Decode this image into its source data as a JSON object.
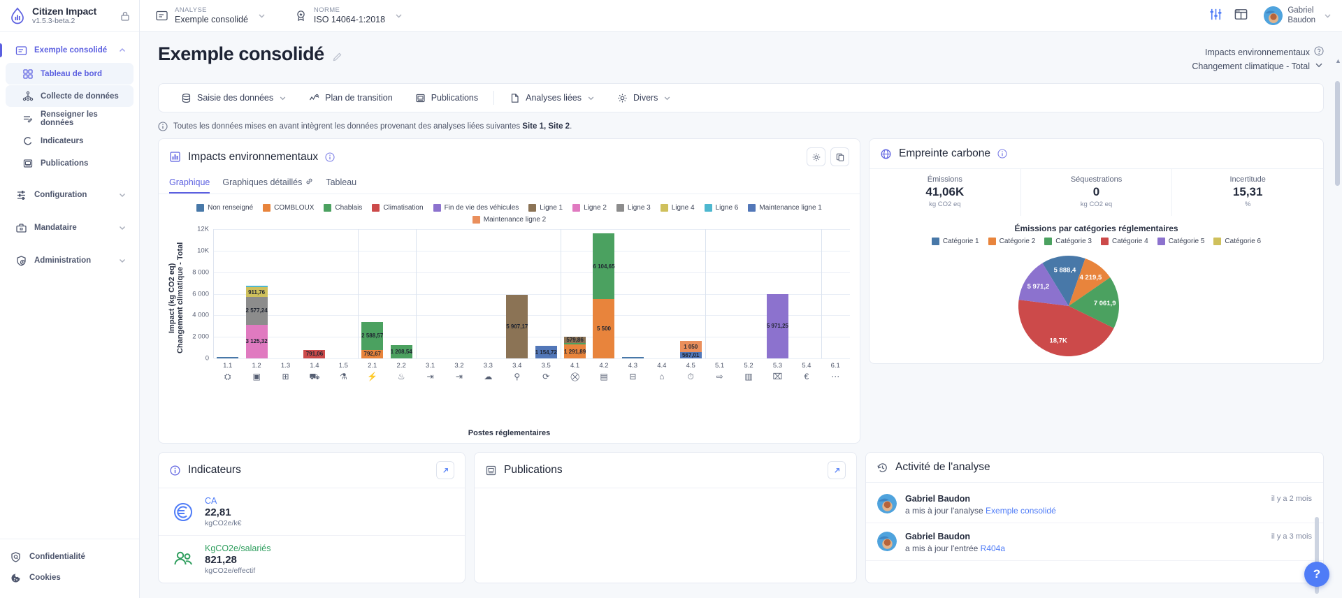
{
  "brand": {
    "name": "Citizen Impact",
    "version": "v1.5.3-beta.2",
    "lock_icon": "lock-icon"
  },
  "sidebar": {
    "root": {
      "label": "Exemple consolidé",
      "icon": "folder-icon",
      "chevron": "chevron-up-icon"
    },
    "sub_items": [
      {
        "label": "Tableau de bord",
        "icon": "dashboard-icon",
        "selected": true
      },
      {
        "label": "Collecte de données",
        "icon": "network-icon",
        "selected": true
      },
      {
        "label": "Renseigner les données",
        "icon": "edit-list-icon",
        "selected": false
      },
      {
        "label": "Indicateurs",
        "icon": "gauge-icon",
        "selected": false
      },
      {
        "label": "Publications",
        "icon": "publication-icon",
        "selected": false
      }
    ],
    "sections": [
      {
        "label": "Configuration",
        "icon": "sliders-icon",
        "chevron": "chevron-down-icon"
      },
      {
        "label": "Mandataire",
        "icon": "briefcase-icon",
        "chevron": "chevron-down-icon"
      },
      {
        "label": "Administration",
        "icon": "shield-user-icon",
        "chevron": "chevron-down-icon"
      }
    ],
    "footer": [
      {
        "label": "Confidentialité",
        "icon": "shield-icon"
      },
      {
        "label": "Cookies",
        "icon": "cookie-icon"
      }
    ]
  },
  "topbar": {
    "analyse": {
      "caption": "ANALYSE",
      "value": "Exemple consolidé",
      "icon": "folder-icon",
      "chevron": "chevron-down-icon"
    },
    "norme": {
      "caption": "NORME",
      "value": "ISO 14064-1:2018",
      "icon": "badge-icon",
      "chevron": "chevron-down-icon"
    },
    "settings_icon": "sliders-icon",
    "layout_icon": "layout-icon",
    "user": {
      "name_line1": "Gabriel",
      "name_line2": "Baudon",
      "avatar": "avatar",
      "chevron": "chevron-down-icon"
    }
  },
  "page": {
    "title": "Exemple consolidé",
    "edit_icon": "pencil-icon",
    "impacts_label": "Impacts environnementaux",
    "impacts_help_icon": "question-circle-icon",
    "impacts_selected": "Changement climatique - Total",
    "impacts_chevron": "chevron-down-icon"
  },
  "toolbar": {
    "items": [
      {
        "label": "Saisie des données",
        "icon": "database-icon",
        "chevron": true
      },
      {
        "label": "Plan de transition",
        "icon": "trend-icon",
        "chevron": false
      },
      {
        "label": "Publications",
        "icon": "publication-icon",
        "chevron": false
      },
      {
        "divider": true
      },
      {
        "label": "Analyses liées",
        "icon": "document-icon",
        "chevron": true
      },
      {
        "label": "Divers",
        "icon": "gear-icon",
        "chevron": true
      }
    ]
  },
  "notice": {
    "icon": "info-icon",
    "text_before": "Toutes les données mises en avant intègrent les données provenant des analyses liées suivantes ",
    "links": "Site 1, Site 2",
    "text_after": "."
  },
  "impacts_card": {
    "icon": "bar-chart-icon",
    "title": "Impacts environnementaux",
    "info_icon": "info-icon",
    "actions": [
      {
        "name": "settings-button",
        "icon": "gear-icon"
      },
      {
        "name": "copy-button",
        "icon": "copy-icon"
      }
    ],
    "tabs": [
      {
        "label": "Graphique",
        "active": true,
        "icon": null
      },
      {
        "label": "Graphiques détaillés",
        "active": false,
        "icon": "link-icon"
      },
      {
        "label": "Tableau",
        "active": false,
        "icon": null
      }
    ]
  },
  "chart_data": {
    "type": "bar",
    "stacked": true,
    "title": "",
    "xlabel": "Postes réglementaires",
    "ylabel": "Impact (kg CO2 eq)\nChangement climatique - Total",
    "ylim": [
      0,
      12000
    ],
    "yticks": [
      0,
      2000,
      4000,
      6000,
      8000,
      10000,
      12000
    ],
    "ytick_labels": [
      "0",
      "2 000",
      "4 000",
      "6 000",
      "8 000",
      "10K",
      "12K"
    ],
    "grid": true,
    "legend_position": "top",
    "series": [
      {
        "name": "Non renseigné",
        "color": "#4878a8"
      },
      {
        "name": "COMBLOUX",
        "color": "#e8843c"
      },
      {
        "name": "Chablais",
        "color": "#4ba160"
      },
      {
        "name": "Climatisation",
        "color": "#cc4a4a"
      },
      {
        "name": "Fin de vie des véhicules",
        "color": "#8c72ce"
      },
      {
        "name": "Ligne 1",
        "color": "#8b7355"
      },
      {
        "name": "Ligne 2",
        "color": "#e07ac0"
      },
      {
        "name": "Ligne 3",
        "color": "#8c8c8c"
      },
      {
        "name": "Ligne 4",
        "color": "#cfc05c"
      },
      {
        "name": "Ligne 6",
        "color": "#4db7cf"
      },
      {
        "name": "Maintenance ligne 1",
        "color": "#5277b8"
      },
      {
        "name": "Maintenance ligne 2",
        "color": "#ea8f5c"
      }
    ],
    "categories": [
      "1.1",
      "1.2",
      "1.3",
      "1.4",
      "1.5",
      "2.1",
      "2.2",
      "3.1",
      "3.2",
      "3.3",
      "3.4",
      "3.5",
      "4.1",
      "4.2",
      "4.3",
      "4.4",
      "4.5",
      "5.1",
      "5.2",
      "5.3",
      "5.4",
      "6.1"
    ],
    "category_icons": [
      "factory-icon",
      "fuel-icon",
      "chart-icon",
      "truck-icon",
      "leak-icon",
      "bolt-icon",
      "steam-icon",
      "freight-icon",
      "freight2-icon",
      "air-icon",
      "person-icon",
      "travel-icon",
      "cart-icon",
      "building-icon",
      "trash-icon",
      "home-icon",
      "energy-icon",
      "sold-icon",
      "use-icon",
      "eol-icon",
      "euro-icon",
      "other-icon"
    ],
    "bars": [
      {
        "category": "1.1",
        "segments": [
          {
            "series": "Non renseigné",
            "value": 120,
            "label": ""
          }
        ]
      },
      {
        "category": "1.2",
        "segments": [
          {
            "series": "Ligne 2",
            "value": 3125.32,
            "label": "3 125,32"
          },
          {
            "series": "Ligne 3",
            "value": 2577.24,
            "label": "2 577,24"
          },
          {
            "series": "Ligne 4",
            "value": 911.76,
            "label": "911,76"
          },
          {
            "series": "Ligne 6",
            "value": 90,
            "label": ""
          }
        ]
      },
      {
        "category": "1.3",
        "segments": []
      },
      {
        "category": "1.4",
        "segments": [
          {
            "series": "Climatisation",
            "value": 791.06,
            "label": "791,06"
          }
        ]
      },
      {
        "category": "1.5",
        "segments": []
      },
      {
        "category": "2.1",
        "segments": [
          {
            "series": "COMBLOUX",
            "value": 792.67,
            "label": "792,67"
          },
          {
            "series": "Chablais",
            "value": 2588.57,
            "label": "2 588,57"
          }
        ]
      },
      {
        "category": "2.2",
        "segments": [
          {
            "series": "Chablais",
            "value": 1208.54,
            "label": "1 208,54"
          }
        ]
      },
      {
        "category": "3.1",
        "segments": []
      },
      {
        "category": "3.2",
        "segments": []
      },
      {
        "category": "3.3",
        "segments": []
      },
      {
        "category": "3.4",
        "segments": [
          {
            "series": "Ligne 1",
            "value": 5907.17,
            "label": "5 907,17"
          }
        ]
      },
      {
        "category": "3.5",
        "segments": [
          {
            "series": "Maintenance ligne 1",
            "value": 1154.72,
            "label": "1 154,72"
          }
        ]
      },
      {
        "category": "4.1",
        "segments": [
          {
            "series": "COMBLOUX",
            "value": 1291.89,
            "label": "1 291,89"
          },
          {
            "series": "Chablais",
            "value": 110,
            "label": ""
          },
          {
            "series": "Ligne 1",
            "value": 579.86,
            "label": "579,86"
          }
        ]
      },
      {
        "category": "4.2",
        "segments": [
          {
            "series": "COMBLOUX",
            "value": 5500,
            "label": "5 500"
          },
          {
            "series": "Chablais",
            "value": 6104.65,
            "label": "6 104,65"
          }
        ]
      },
      {
        "category": "4.3",
        "segments": [
          {
            "series": "Non renseigné",
            "value": 70,
            "label": ""
          }
        ]
      },
      {
        "category": "4.4",
        "segments": []
      },
      {
        "category": "4.5",
        "segments": [
          {
            "series": "Maintenance ligne 1",
            "value": 567.01,
            "label": "567,01"
          },
          {
            "series": "Maintenance ligne 2",
            "value": 1050,
            "label": "1 050"
          }
        ]
      },
      {
        "category": "5.1",
        "segments": []
      },
      {
        "category": "5.2",
        "segments": []
      },
      {
        "category": "5.3",
        "segments": [
          {
            "series": "Fin de vie des véhicules",
            "value": 5971.25,
            "label": "5 971,25"
          }
        ]
      },
      {
        "category": "5.4",
        "segments": []
      },
      {
        "category": "6.1",
        "segments": []
      }
    ]
  },
  "carbon_card": {
    "icon": "globe-icon",
    "title": "Empreinte carbone",
    "info_icon": "info-icon",
    "kpis": [
      {
        "label": "Émissions",
        "value": "41,06K",
        "unit": "kg CO2 eq"
      },
      {
        "label": "Séquestrations",
        "value": "0",
        "unit": "kg CO2 eq"
      },
      {
        "label": "Incertitude",
        "value": "15,31",
        "unit": "%"
      }
    ],
    "pie": {
      "type": "pie",
      "title": "Émissions par catégories réglementaires",
      "legend": [
        {
          "name": "Catégorie 1",
          "color": "#4878a8"
        },
        {
          "name": "Catégorie 2",
          "color": "#e8843c"
        },
        {
          "name": "Catégorie 3",
          "color": "#4ba160"
        },
        {
          "name": "Catégorie 4",
          "color": "#cc4a4a"
        },
        {
          "name": "Catégorie 5",
          "color": "#8c72ce"
        },
        {
          "name": "Catégorie 6",
          "color": "#cfc05c"
        }
      ],
      "slices": [
        {
          "name": "Catégorie 1",
          "value": 5888.4,
          "label": "5 888,4",
          "color": "#4878a8"
        },
        {
          "name": "Catégorie 2",
          "value": 4219.5,
          "label": "4 219,5",
          "color": "#e8843c"
        },
        {
          "name": "Catégorie 3",
          "value": 7061.9,
          "label": "7 061,9",
          "color": "#4ba160"
        },
        {
          "name": "Catégorie 4",
          "value": 18700,
          "label": "18,7K",
          "color": "#cc4a4a"
        },
        {
          "name": "Catégorie 5",
          "value": 5971.2,
          "label": "5 971,2",
          "color": "#8c72ce"
        }
      ]
    }
  },
  "indicators_card": {
    "icon": "info-icon",
    "title": "Indicateurs",
    "expand_icon": "expand-icon",
    "rows": [
      {
        "icon": "euro-circle-icon",
        "name": "CA",
        "value": "22,81",
        "unit": "kgCO2e/k€",
        "color": "blue"
      },
      {
        "icon": "people-icon",
        "name": "KgCO2e/salariés",
        "value": "821,28",
        "unit": "kgCO2e/effectif",
        "color": "green"
      }
    ]
  },
  "publications_card": {
    "icon": "publication-icon",
    "title": "Publications",
    "expand_icon": "expand-icon"
  },
  "activity_card": {
    "icon": "history-icon",
    "title": "Activité de l'analyse",
    "items": [
      {
        "avatar": "avatar",
        "name": "Gabriel Baudon",
        "action": "a mis à jour l'analyse ",
        "link": "Exemple consolidé",
        "time": "il y a 2 mois"
      },
      {
        "avatar": "avatar",
        "name": "Gabriel Baudon",
        "action": "a mis à jour l'entrée ",
        "link": "R404a",
        "time": "il y a 3 mois"
      }
    ]
  },
  "help_fab": {
    "label": "?",
    "color": "#4f7cf7"
  }
}
